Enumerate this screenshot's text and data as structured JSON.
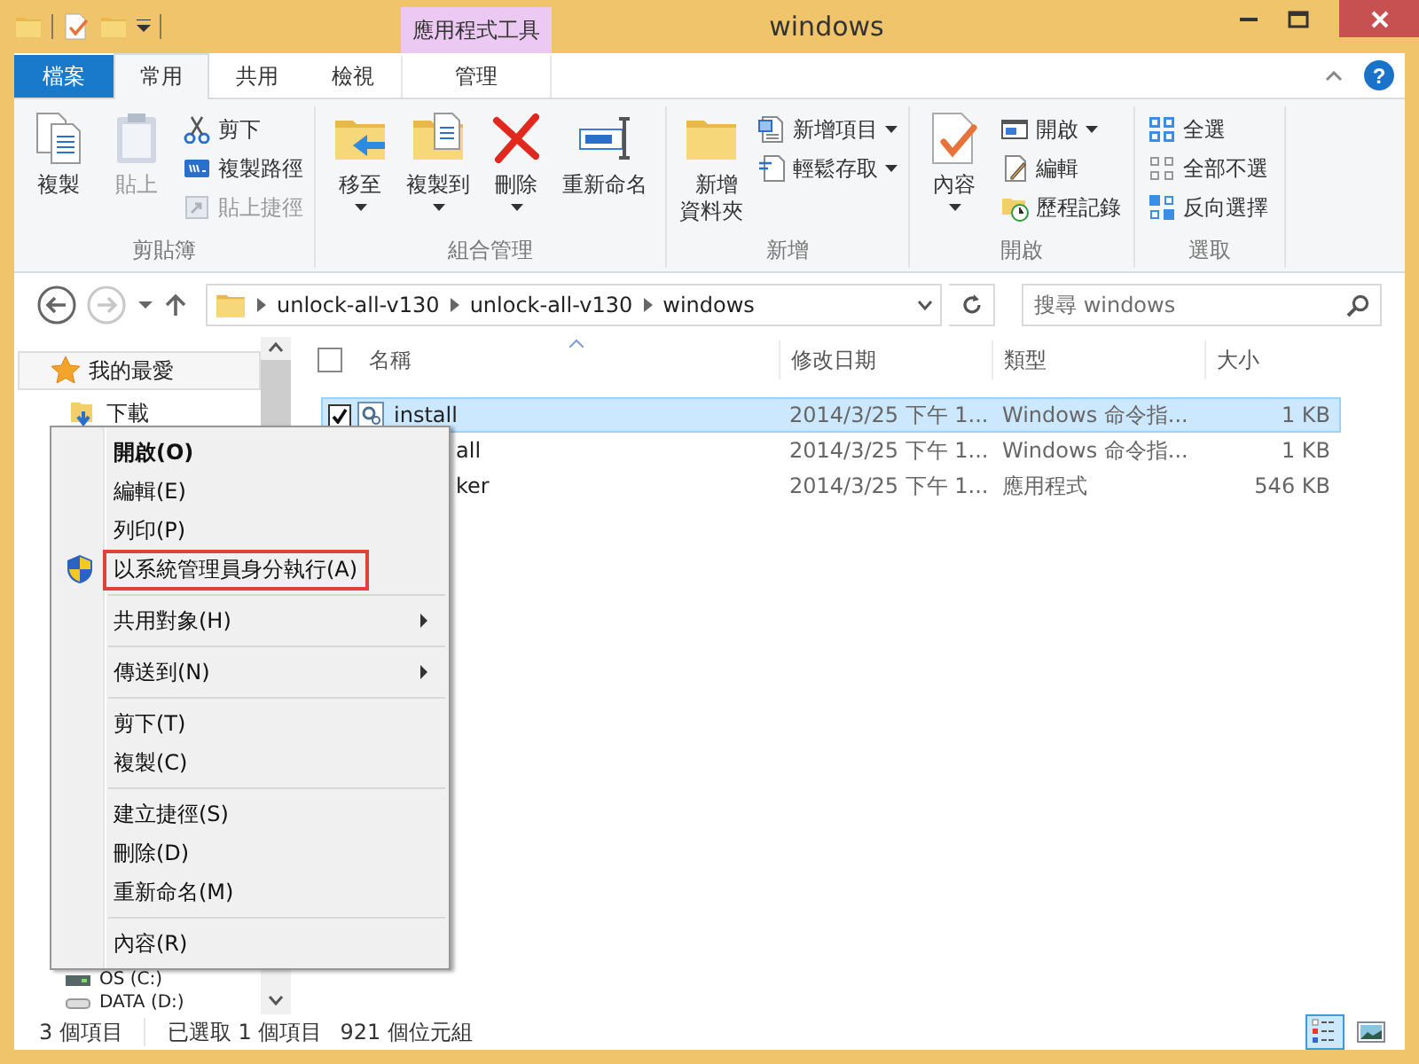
{
  "window": {
    "title": "windows"
  },
  "contextual_group": {
    "label": "應用程式工具"
  },
  "tabs": [
    {
      "label": "檔案",
      "kind": "file",
      "selected": false
    },
    {
      "label": "常用",
      "kind": "normal",
      "selected": true
    },
    {
      "label": "共用",
      "kind": "normal",
      "selected": false
    },
    {
      "label": "檢視",
      "kind": "normal",
      "selected": false
    },
    {
      "label": "管理",
      "kind": "contextual",
      "selected": false
    }
  ],
  "help_button": {
    "label": "?"
  },
  "ribbon": {
    "groups": [
      {
        "label": "剪貼簿",
        "buttons": [
          {
            "label": "複製",
            "kind": "large",
            "disabled": false,
            "dropdown": false
          },
          {
            "label": "貼上",
            "kind": "large",
            "disabled": true,
            "dropdown": false
          },
          {
            "label": "剪下",
            "kind": "small",
            "disabled": false,
            "dropdown": false
          },
          {
            "label": "複製路徑",
            "kind": "small",
            "disabled": false,
            "dropdown": false
          },
          {
            "label": "貼上捷徑",
            "kind": "small",
            "disabled": true,
            "dropdown": false
          }
        ]
      },
      {
        "label": "組合管理",
        "buttons": [
          {
            "label": "移至",
            "kind": "large",
            "disabled": false,
            "dropdown": true
          },
          {
            "label": "複製到",
            "kind": "large",
            "disabled": false,
            "dropdown": true
          },
          {
            "label": "刪除",
            "kind": "large",
            "disabled": false,
            "dropdown": true
          },
          {
            "label": "重新命名",
            "kind": "large",
            "disabled": false,
            "dropdown": false
          }
        ]
      },
      {
        "label": "新增",
        "buttons": [
          {
            "label": "新增資料夾",
            "kind": "large_two_line",
            "disabled": false,
            "dropdown": false
          },
          {
            "label": "新增項目",
            "kind": "small",
            "disabled": false,
            "dropdown": true
          },
          {
            "label": "輕鬆存取",
            "kind": "small",
            "disabled": false,
            "dropdown": true
          }
        ]
      },
      {
        "label": "開啟",
        "buttons": [
          {
            "label": "內容",
            "kind": "large",
            "disabled": false,
            "dropdown": true
          },
          {
            "label": "開啟",
            "kind": "small",
            "disabled": false,
            "dropdown": true
          },
          {
            "label": "編輯",
            "kind": "small",
            "disabled": false,
            "dropdown": false
          },
          {
            "label": "歷程記錄",
            "kind": "small",
            "disabled": false,
            "dropdown": false
          }
        ]
      },
      {
        "label": "選取",
        "buttons": [
          {
            "label": "全選",
            "kind": "small",
            "disabled": false,
            "dropdown": false
          },
          {
            "label": "全部不選",
            "kind": "small",
            "disabled": false,
            "dropdown": false
          },
          {
            "label": "反向選擇",
            "kind": "small",
            "disabled": false,
            "dropdown": false
          }
        ]
      }
    ]
  },
  "nav_buttons": [
    {
      "kind": "back",
      "disabled": false
    },
    {
      "kind": "forward",
      "disabled": true
    },
    {
      "kind": "recent",
      "disabled": false
    },
    {
      "kind": "up",
      "disabled": false
    }
  ],
  "address": {
    "segments": [
      "unlock-all-v130",
      "unlock-all-v130",
      "windows"
    ]
  },
  "search": {
    "placeholder": "搜尋 windows"
  },
  "nav_pane": {
    "items": [
      {
        "label": "我的最愛",
        "selected": true,
        "children": [
          {
            "label": "下載",
            "selected": false
          }
        ]
      }
    ],
    "drives": [
      {
        "label": "OS (C:)"
      },
      {
        "label": "DATA (D:)"
      }
    ]
  },
  "file_list": {
    "select_all": {
      "checked": false
    },
    "columns": [
      {
        "label": "名稱",
        "sorted": true
      },
      {
        "label": "修改日期",
        "sorted": false
      },
      {
        "label": "類型",
        "sorted": false
      },
      {
        "label": "大小",
        "sorted": false
      }
    ],
    "rows": [
      {
        "name": "install",
        "covered": false,
        "date": "2014/3/25 下午 1...",
        "type": "Windows 命令指...",
        "size": "1 KB",
        "selected": true
      },
      {
        "name": "all",
        "covered": true,
        "date": "2014/3/25 下午 1...",
        "type": "Windows 命令指...",
        "size": "1 KB",
        "selected": false
      },
      {
        "name": "ker",
        "covered": true,
        "date": "2014/3/25 下午 1...",
        "type": "應用程式",
        "size": "546 KB",
        "selected": false
      }
    ]
  },
  "context_menu": {
    "groups": [
      [
        {
          "label": "開啟(O)",
          "kind": "plain",
          "default": true,
          "submenu": false,
          "marked": false
        },
        {
          "label": "編輯(E)",
          "kind": "plain",
          "default": false,
          "submenu": false,
          "marked": false
        },
        {
          "label": "列印(P)",
          "kind": "plain",
          "default": false,
          "submenu": false,
          "marked": false
        },
        {
          "label": "以系統管理員身分執行(A)",
          "kind": "elevated",
          "default": false,
          "submenu": false,
          "marked": true
        }
      ],
      [
        {
          "label": "共用對象(H)",
          "kind": "plain",
          "default": false,
          "submenu": true,
          "marked": false
        }
      ],
      [
        {
          "label": "傳送到(N)",
          "kind": "plain",
          "default": false,
          "submenu": true,
          "marked": false
        }
      ],
      [
        {
          "label": "剪下(T)",
          "kind": "plain",
          "default": false,
          "submenu": false,
          "marked": false
        },
        {
          "label": "複製(C)",
          "kind": "plain",
          "default": false,
          "submenu": false,
          "marked": false
        }
      ],
      [
        {
          "label": "建立捷徑(S)",
          "kind": "plain",
          "default": false,
          "submenu": false,
          "marked": false
        },
        {
          "label": "刪除(D)",
          "kind": "plain",
          "default": false,
          "submenu": false,
          "marked": false
        },
        {
          "label": "重新命名(M)",
          "kind": "plain",
          "default": false,
          "submenu": false,
          "marked": false
        }
      ],
      [
        {
          "label": "內容(R)",
          "kind": "plain",
          "default": false,
          "submenu": false,
          "marked": false
        }
      ]
    ]
  },
  "status_bar": {
    "item_count": "3 個項目",
    "selection": "已選取 1 個項目",
    "size": "921 個位元組"
  },
  "view_buttons": [
    {
      "kind": "details",
      "selected": true
    },
    {
      "kind": "large_icons",
      "selected": false
    }
  ]
}
